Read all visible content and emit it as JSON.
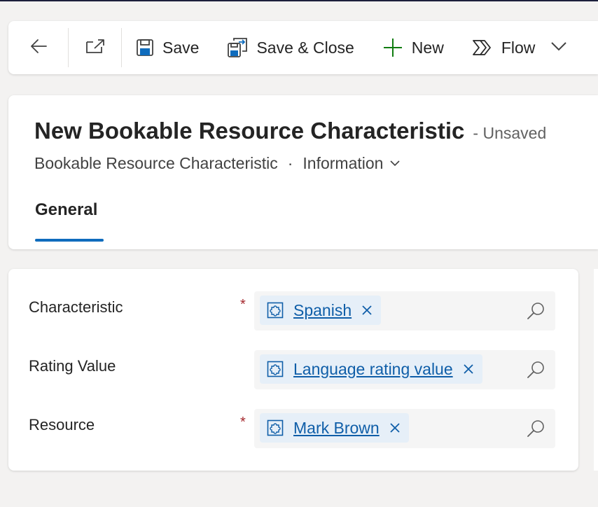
{
  "command_bar": {
    "back_icon": "arrow-left-icon",
    "popout_icon": "open-in-new-window-icon",
    "save_label": "Save",
    "save_icon": "floppy-disk-icon",
    "save_close_label": "Save & Close",
    "save_close_icon": "save-and-close-icon",
    "new_label": "New",
    "new_icon": "plus-icon",
    "flow_label": "Flow",
    "flow_icon": "flow-icon",
    "overflow_icon": "chevron-down-icon"
  },
  "header": {
    "title": "New Bookable Resource Characteristic",
    "status": "- Unsaved",
    "entity_name": "Bookable Resource Characteristic",
    "separator": "·",
    "form_selector": "Information",
    "form_selector_icon": "chevron-down-icon",
    "tabs": [
      {
        "label": "General",
        "selected": true
      }
    ]
  },
  "form": {
    "fields": [
      {
        "label": "Characteristic",
        "required": true,
        "required_marker": "*",
        "value": "Spanish",
        "icon": "entity-puzzle-icon"
      },
      {
        "label": "Rating Value",
        "required": false,
        "required_marker": "",
        "value": "Language rating value",
        "icon": "entity-puzzle-icon"
      },
      {
        "label": "Resource",
        "required": true,
        "required_marker": "*",
        "value": "Mark Brown",
        "icon": "entity-puzzle-icon"
      }
    ],
    "remove_icon": "close-icon",
    "search_icon": "search-icon"
  },
  "colors": {
    "accent": "#0f6cbd",
    "link": "#0f5ea8",
    "new_plus": "#107c10",
    "required": "#a4262c",
    "background": "#f3f2f1",
    "tag_background": "#e6eff8"
  }
}
